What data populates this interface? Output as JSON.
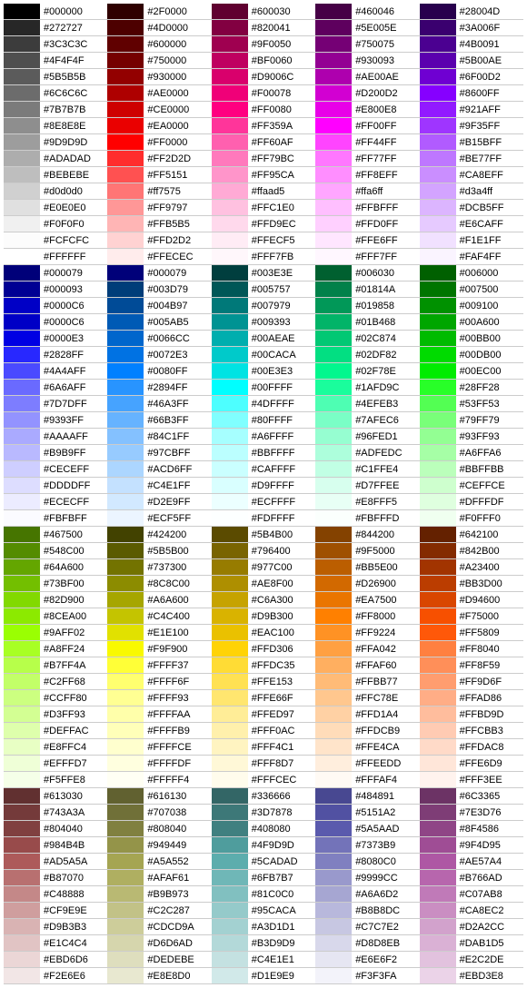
{
  "rows": [
    [
      "#000000",
      "#2F0000",
      "#600030",
      "#460046",
      "#28004D"
    ],
    [
      "#272727",
      "#4D0000",
      "#820041",
      "#5E005E",
      "#3A006F"
    ],
    [
      "#3C3C3C",
      "#600000",
      "#9F0050",
      "#750075",
      "#4B0091"
    ],
    [
      "#4F4F4F",
      "#750000",
      "#BF0060",
      "#930093",
      "#5B00AE"
    ],
    [
      "#5B5B5B",
      "#930000",
      "#D9006C",
      "#AE00AE",
      "#6F00D2"
    ],
    [
      "#6C6C6C",
      "#AE0000",
      "#F00078",
      "#D200D2",
      "#8600FF"
    ],
    [
      "#7B7B7B",
      "#CE0000",
      "#FF0080",
      "#E800E8",
      "#921AFF"
    ],
    [
      "#8E8E8E",
      "#EA0000",
      "#FF359A",
      "#FF00FF",
      "#9F35FF"
    ],
    [
      "#9D9D9D",
      "#FF0000",
      "#FF60AF",
      "#FF44FF",
      "#B15BFF"
    ],
    [
      "#ADADAD",
      "#FF2D2D",
      "#FF79BC",
      "#FF77FF",
      "#BE77FF"
    ],
    [
      "#BEBEBE",
      "#FF5151",
      "#FF95CA",
      "#FF8EFF",
      "#CA8EFF"
    ],
    [
      "#d0d0d0",
      "#ff7575",
      "#ffaad5",
      "#ffa6ff",
      "#d3a4ff"
    ],
    [
      "#E0E0E0",
      "#FF9797",
      "#FFC1E0",
      "#FFBFFF",
      "#DCB5FF"
    ],
    [
      "#F0F0F0",
      "#FFB5B5",
      "#FFD9EC",
      "#FFD0FF",
      "#E6CAFF"
    ],
    [
      "#FCFCFC",
      "#FFD2D2",
      "#FFECF5",
      "#FFE6FF",
      "#F1E1FF"
    ],
    [
      "#FFFFFF",
      "#FFECEC",
      "#FFF7FB",
      "#FFF7FF",
      "#FAF4FF"
    ],
    [
      "#000079",
      "#000079",
      "#003E3E",
      "#006030",
      "#006000"
    ],
    [
      "#000093",
      "#003D79",
      "#005757",
      "#01814A",
      "#007500"
    ],
    [
      "#0000C6",
      "#004B97",
      "#007979",
      "#019858",
      "#009100"
    ],
    [
      "#0000C6",
      "#005AB5",
      "#009393",
      "#01B468",
      "#00A600"
    ],
    [
      "#0000E3",
      "#0066CC",
      "#00AEAE",
      "#02C874",
      "#00BB00"
    ],
    [
      "#2828FF",
      "#0072E3",
      "#00CACA",
      "#02DF82",
      "#00DB00"
    ],
    [
      "#4A4AFF",
      "#0080FF",
      "#00E3E3",
      "#02F78E",
      "#00EC00"
    ],
    [
      "#6A6AFF",
      "#2894FF",
      "#00FFFF",
      "#1AFD9C",
      "#28FF28"
    ],
    [
      "#7D7DFF",
      "#46A3FF",
      "#4DFFFF",
      "#4EFEB3",
      "#53FF53"
    ],
    [
      "#9393FF",
      "#66B3FF",
      "#80FFFF",
      "#7AFEC6",
      "#79FF79"
    ],
    [
      "#AAAAFF",
      "#84C1FF",
      "#A6FFFF",
      "#96FED1",
      "#93FF93"
    ],
    [
      "#B9B9FF",
      "#97CBFF",
      "#BBFFFF",
      "#ADFEDC",
      "#A6FFA6"
    ],
    [
      "#CECEFF",
      "#ACD6FF",
      "#CAFFFF",
      "#C1FFE4",
      "#BBFFBB"
    ],
    [
      "#DDDDFF",
      "#C4E1FF",
      "#D9FFFF",
      "#D7FFEE",
      "#CEFFCE"
    ],
    [
      "#ECECFF",
      "#D2E9FF",
      "#ECFFFF",
      "#E8FFF5",
      "#DFFFDF"
    ],
    [
      "#FBFBFF",
      "#ECF5FF",
      "#FDFFFF",
      "#FBFFFD",
      "#F0FFF0"
    ],
    [
      "#467500",
      "#424200",
      "#5B4B00",
      "#844200",
      "#642100"
    ],
    [
      "#548C00",
      "#5B5B00",
      "#796400",
      "#9F5000",
      "#842B00"
    ],
    [
      "#64A600",
      "#737300",
      "#977C00",
      "#BB5E00",
      "#A23400"
    ],
    [
      "#73BF00",
      "#8C8C00",
      "#AE8F00",
      "#D26900",
      "#BB3D00"
    ],
    [
      "#82D900",
      "#A6A600",
      "#C6A300",
      "#EA7500",
      "#D94600"
    ],
    [
      "#8CEA00",
      "#C4C400",
      "#D9B300",
      "#FF8000",
      "#F75000"
    ],
    [
      "#9AFF02",
      "#E1E100",
      "#EAC100",
      "#FF9224",
      "#FF5809"
    ],
    [
      "#A8FF24",
      "#F9F900",
      "#FFD306",
      "#FFA042",
      "#FF8040"
    ],
    [
      "#B7FF4A",
      "#FFFF37",
      "#FFDC35",
      "#FFAF60",
      "#FF8F59"
    ],
    [
      "#C2FF68",
      "#FFFF6F",
      "#FFE153",
      "#FFBB77",
      "#FF9D6F"
    ],
    [
      "#CCFF80",
      "#FFFF93",
      "#FFE66F",
      "#FFC78E",
      "#FFAD86"
    ],
    [
      "#D3FF93",
      "#FFFFAA",
      "#FFED97",
      "#FFD1A4",
      "#FFBD9D"
    ],
    [
      "#DEFFAC",
      "#FFFFB9",
      "#FFF0AC",
      "#FFDCB9",
      "#FFCBB3"
    ],
    [
      "#E8FFC4",
      "#FFFFCE",
      "#FFF4C1",
      "#FFE4CA",
      "#FFDAC8"
    ],
    [
      "#EFFFD7",
      "#FFFFDF",
      "#FFF8D7",
      "#FFEEDD",
      "#FFE6D9"
    ],
    [
      "#F5FFE8",
      "#FFFFF4",
      "#FFFCEC",
      "#FFFAF4",
      "#FFF3EE"
    ],
    [
      "#613030",
      "#616130",
      "#336666",
      "#484891",
      "#6C3365"
    ],
    [
      "#743A3A",
      "#707038",
      "#3D7878",
      "#5151A2",
      "#7E3D76"
    ],
    [
      "#804040",
      "#808040",
      "#408080",
      "#5A5AAD",
      "#8F4586"
    ],
    [
      "#984B4B",
      "#949449",
      "#4F9D9D",
      "#7373B9",
      "#9F4D95"
    ],
    [
      "#AD5A5A",
      "#A5A552",
      "#5CADAD",
      "#8080C0",
      "#AE57A4"
    ],
    [
      "#B87070",
      "#AFAF61",
      "#6FB7B7",
      "#9999CC",
      "#B766AD"
    ],
    [
      "#C48888",
      "#B9B973",
      "#81C0C0",
      "#A6A6D2",
      "#C07AB8"
    ],
    [
      "#CF9E9E",
      "#C2C287",
      "#95CACA",
      "#B8B8DC",
      "#CA8EC2"
    ],
    [
      "#D9B3B3",
      "#CDCD9A",
      "#A3D1D1",
      "#C7C7E2",
      "#D2A2CC"
    ],
    [
      "#E1C4C4",
      "#D6D6AD",
      "#B3D9D9",
      "#D8D8EB",
      "#DAB1D5"
    ],
    [
      "#EBD6D6",
      "#DEDEBE",
      "#C4E1E1",
      "#E6E6F2",
      "#E2C2DE"
    ],
    [
      "#F2E6E6",
      "#E8E8D0",
      "#D1E9E9",
      "#F3F3FA",
      "#EBD3E8"
    ]
  ]
}
